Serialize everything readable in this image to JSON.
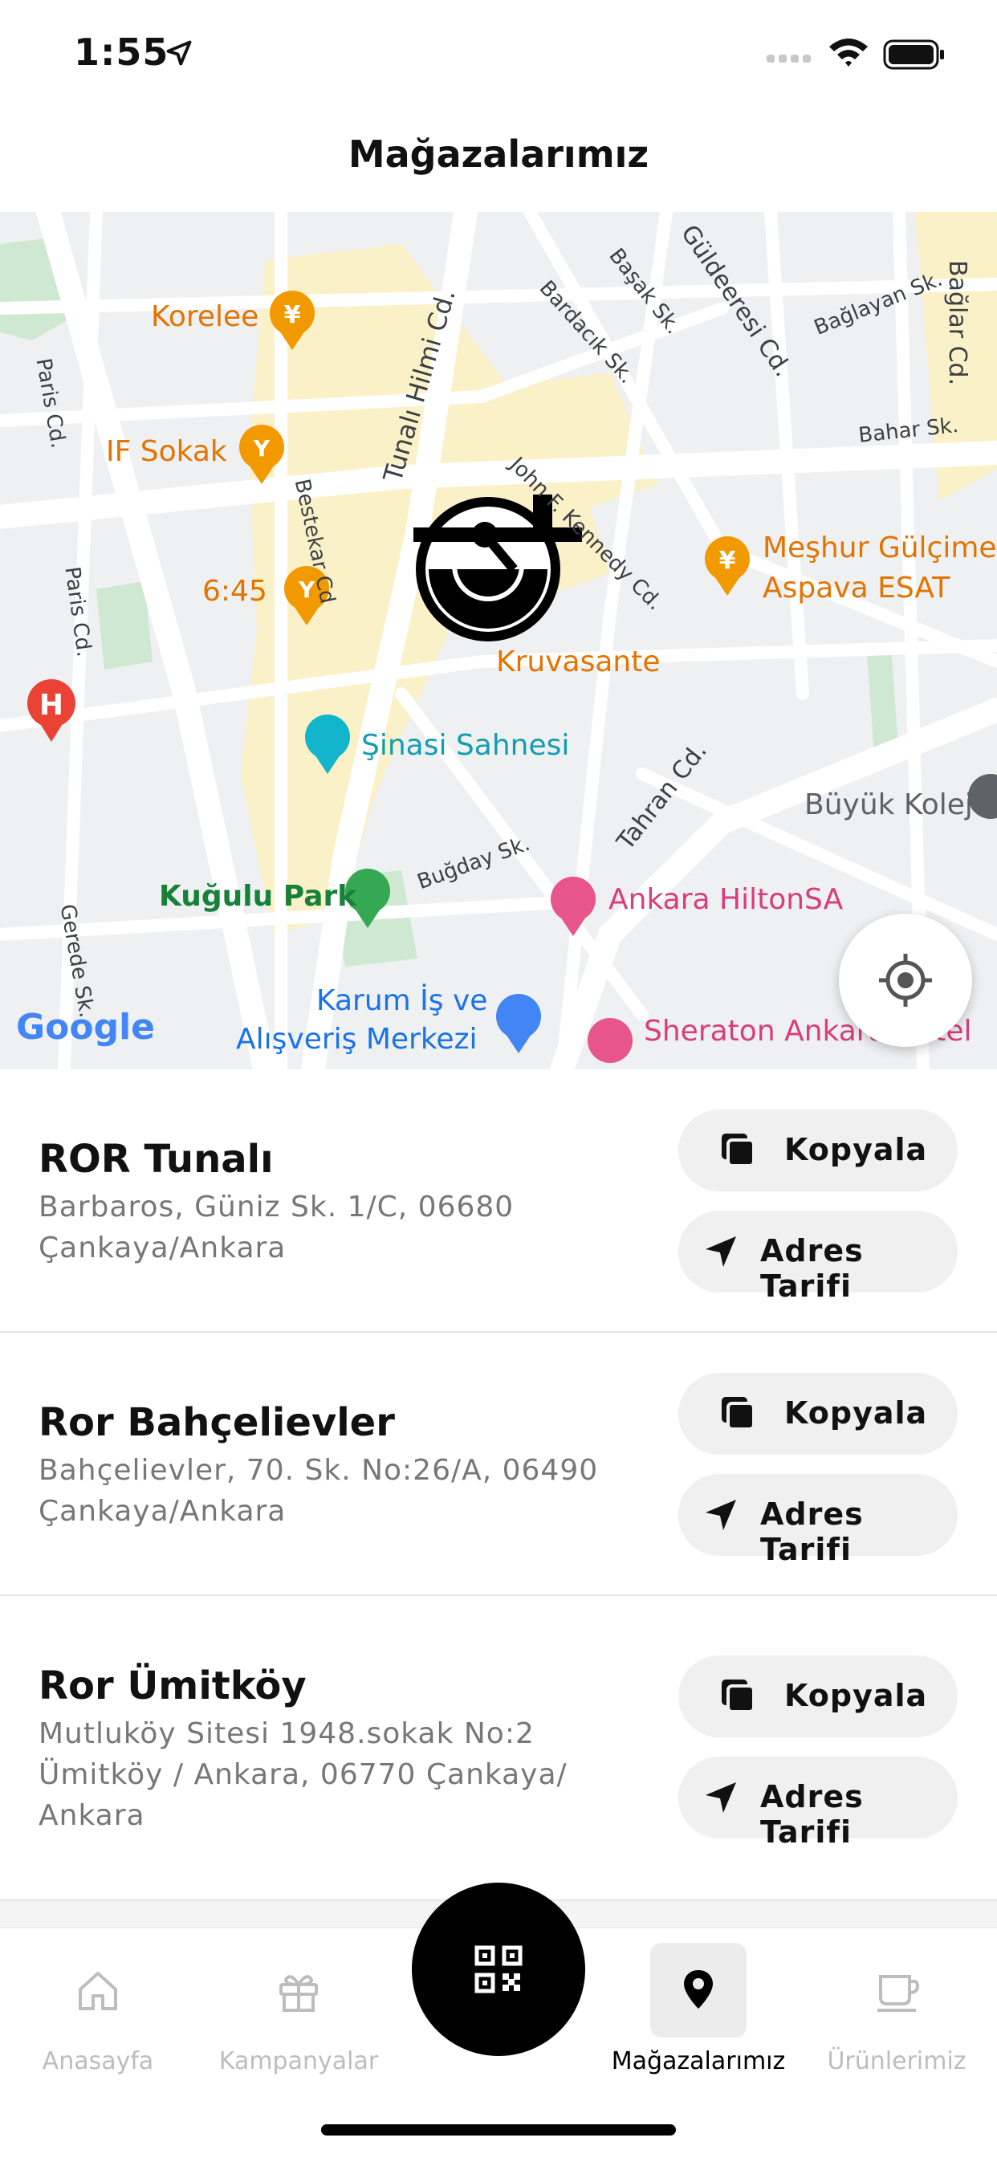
{
  "status_bar": {
    "time": "1:55"
  },
  "header": {
    "title": "Mağazalarımız"
  },
  "map": {
    "pois": [
      {
        "label": "Korelee",
        "color": "#e37400"
      },
      {
        "label": "IF Sokak",
        "color": "#e37400"
      },
      {
        "label": "6:45",
        "color": "#e37400"
      },
      {
        "label": "Kruvasante",
        "color": "#e37400"
      },
      {
        "label": "Meşhur Gülçime",
        "color": "#e37400"
      },
      {
        "label": "Aspava ESAT",
        "color": "#e37400"
      },
      {
        "label": "Şinasi Sahnesi",
        "color": "#129eaf"
      },
      {
        "label": "Büyük Kolej",
        "color": "#5f6368"
      },
      {
        "label": "Kuğulu Park",
        "color": "#188038"
      },
      {
        "label": "Ankara HiltonSA",
        "color": "#d93d7b"
      },
      {
        "label": "Karum İş ve",
        "color": "#1a73e8"
      },
      {
        "label": "Alışveriş Merkezi",
        "color": "#1a73e8"
      },
      {
        "label": "Sheraton Ankara Hotel",
        "color": "#d93d7b"
      }
    ],
    "streets": [
      "Tunalı Hilmi Cd.",
      "Bestekar Cd",
      "John F. Kennedy Cd.",
      "Tahran Cd.",
      "Buğday Sk.",
      "Paris Cd.",
      "Paris Cd.",
      "Gerede Sk.",
      "Bardacık Sk.",
      "Başak Sk.",
      "Bağlayan Sk.",
      "Bahar Sk.",
      "Bağlar Cd.",
      "Güldeeresi Cd."
    ],
    "google_logo": "Google"
  },
  "stores": [
    {
      "name": "ROR Tunalı",
      "address": "Barbaros, Güniz Sk. 1/C, 06680 Çankaya/Ankara",
      "copy_label": "Kopyala",
      "directions_label": "Adres Tarifi"
    },
    {
      "name": "Ror Bahçelievler",
      "address": "Bahçelievler, 70. Sk. No:26/A, 06490 Çankaya/Ankara",
      "copy_label": "Kopyala",
      "directions_label": "Adres Tarifi"
    },
    {
      "name": "Ror Ümitköy",
      "address": "Mutluköy Sitesi 1948.sokak No:2 Ümitköy / Ankara, 06770 Çankaya/ Ankara",
      "copy_label": "Kopyala",
      "directions_label": "Adres Tarifi"
    }
  ],
  "bottom_nav": {
    "items": [
      {
        "label": "Anasayfa",
        "icon": "home-icon"
      },
      {
        "label": "Kampanyalar",
        "icon": "gift-icon"
      },
      {
        "label": "Mağazalarımız",
        "icon": "location-pin-icon",
        "active": true
      },
      {
        "label": "Ürünlerimiz",
        "icon": "coffee-cup-icon"
      }
    ],
    "qr_icon": "qr-code-icon"
  },
  "colors": {
    "active": "#000000",
    "inactive": "#bdbdbd",
    "pill_bg": "#f0f0f0"
  }
}
